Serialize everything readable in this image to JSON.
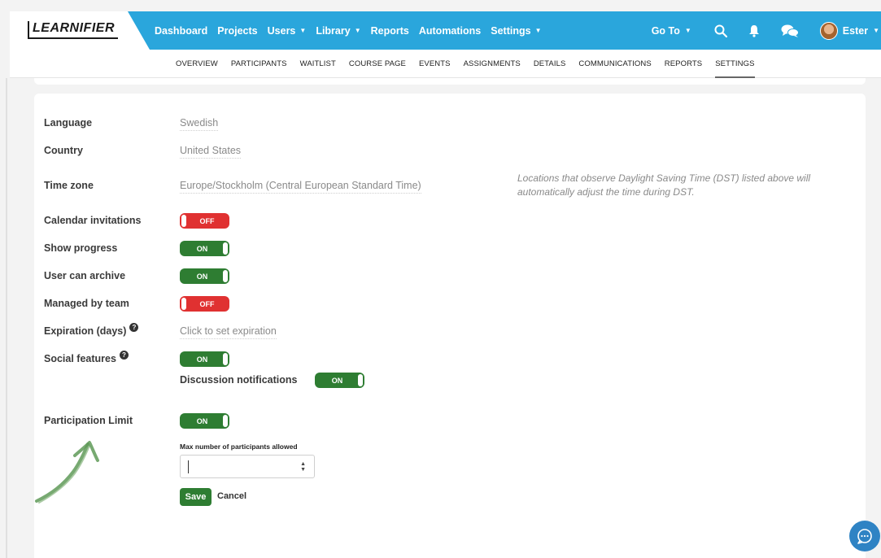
{
  "app": {
    "logo": "LEARNIFIER"
  },
  "topnav": {
    "items": [
      {
        "label": "Dashboard",
        "caret": false
      },
      {
        "label": "Projects",
        "caret": false
      },
      {
        "label": "Users",
        "caret": true
      },
      {
        "label": "Library",
        "caret": true
      },
      {
        "label": "Reports",
        "caret": false
      },
      {
        "label": "Automations",
        "caret": false
      },
      {
        "label": "Settings",
        "caret": true
      }
    ],
    "goto_label": "Go To",
    "user_name": "Ester",
    "icons": [
      "search-icon",
      "bell-icon",
      "chat-bubbles-icon"
    ],
    "color": "#2aa6dc"
  },
  "subnav": {
    "items": [
      "OVERVIEW",
      "PARTICIPANTS",
      "WAITLIST",
      "COURSE PAGE",
      "EVENTS",
      "ASSIGNMENTS",
      "DETAILS",
      "COMMUNICATIONS",
      "REPORTS",
      "SETTINGS"
    ],
    "active": "SETTINGS"
  },
  "settings": {
    "language": {
      "label": "Language",
      "value": "Swedish"
    },
    "country": {
      "label": "Country",
      "value": "United States"
    },
    "timezone": {
      "label": "Time zone",
      "value": "Europe/Stockholm (Central European Standard Time)",
      "hint": "Locations that observe Daylight Saving Time (DST) listed above will automatically adjust the time during DST."
    },
    "calendar_invitations": {
      "label": "Calendar invitations",
      "state": "OFF"
    },
    "show_progress": {
      "label": "Show progress",
      "state": "ON"
    },
    "user_can_archive": {
      "label": "User can archive",
      "state": "ON"
    },
    "managed_by_team": {
      "label": "Managed by team",
      "state": "OFF"
    },
    "expiration": {
      "label": "Expiration (days)",
      "value": "Click to set expiration",
      "help": "?"
    },
    "social_features": {
      "label": "Social features",
      "state": "ON",
      "help": "?"
    },
    "discussion_notifications": {
      "label": "Discussion notifications",
      "state": "ON"
    },
    "participation_limit": {
      "label": "Participation Limit",
      "state": "ON"
    },
    "max_participants": {
      "label": "Max number of participants allowed",
      "value": ""
    },
    "save_label": "Save",
    "cancel_label": "Cancel"
  },
  "colors": {
    "on": "#2e7d32",
    "off": "#e03131",
    "chat_button": "#2f83c4"
  }
}
